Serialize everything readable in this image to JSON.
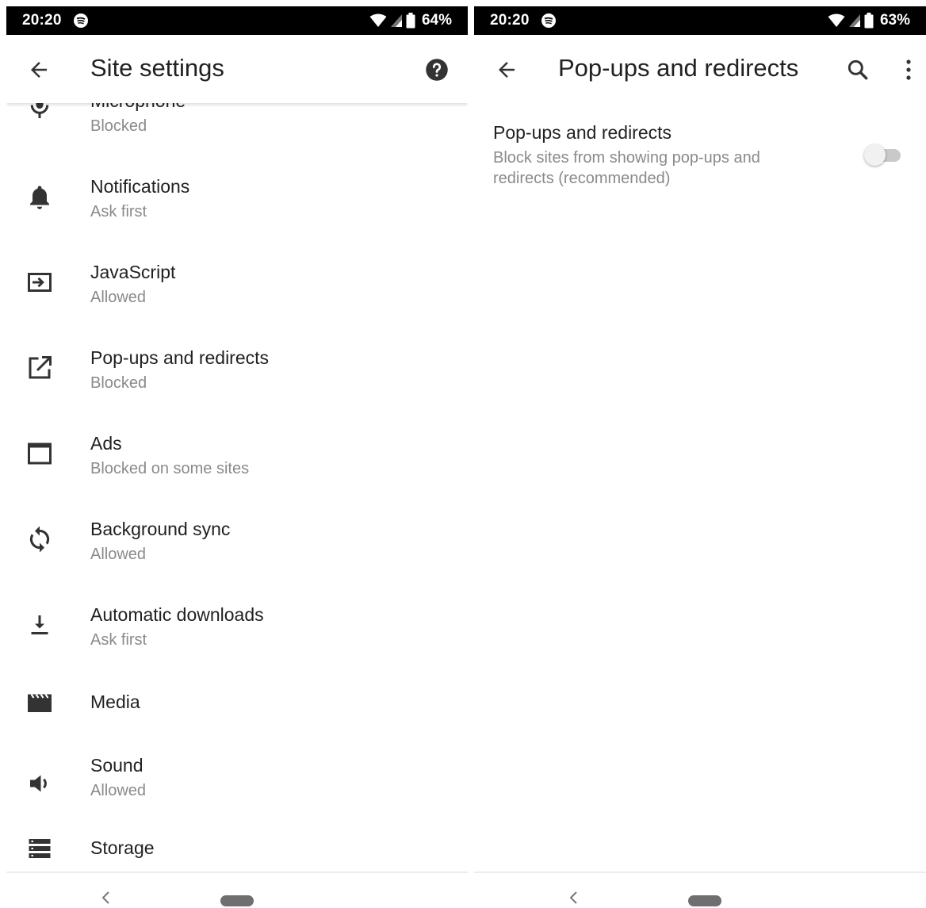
{
  "left": {
    "status": {
      "time": "20:20",
      "battery": "64%"
    },
    "appbar": {
      "title": "Site settings"
    },
    "items": [
      {
        "title": "Microphone",
        "subtitle": "Blocked",
        "icon": "microphone-icon"
      },
      {
        "title": "Notifications",
        "subtitle": "Ask first",
        "icon": "bell-icon"
      },
      {
        "title": "JavaScript",
        "subtitle": "Allowed",
        "icon": "javascript-icon"
      },
      {
        "title": "Pop-ups and redirects",
        "subtitle": "Blocked",
        "icon": "open-in-new-icon"
      },
      {
        "title": "Ads",
        "subtitle": "Blocked on some sites",
        "icon": "window-icon"
      },
      {
        "title": "Background sync",
        "subtitle": "Allowed",
        "icon": "sync-icon"
      },
      {
        "title": "Automatic downloads",
        "subtitle": "Ask first",
        "icon": "download-icon"
      },
      {
        "title": "Media",
        "subtitle": "",
        "icon": "movie-icon"
      },
      {
        "title": "Sound",
        "subtitle": "Allowed",
        "icon": "volume-icon"
      },
      {
        "title": "Storage",
        "subtitle": "",
        "icon": "storage-icon"
      }
    ]
  },
  "right": {
    "status": {
      "time": "20:20",
      "battery": "63%"
    },
    "appbar": {
      "title": "Pop-ups and redirects"
    },
    "pref": {
      "title": "Pop-ups and redirects",
      "summary": "Block sites from showing pop-ups and redirects (recommended)",
      "toggle_on": false
    }
  },
  "colors": {
    "statusbar": "#000000",
    "text_primary": "#212121",
    "text_secondary": "#8a8a8a",
    "icon": "#333333"
  }
}
